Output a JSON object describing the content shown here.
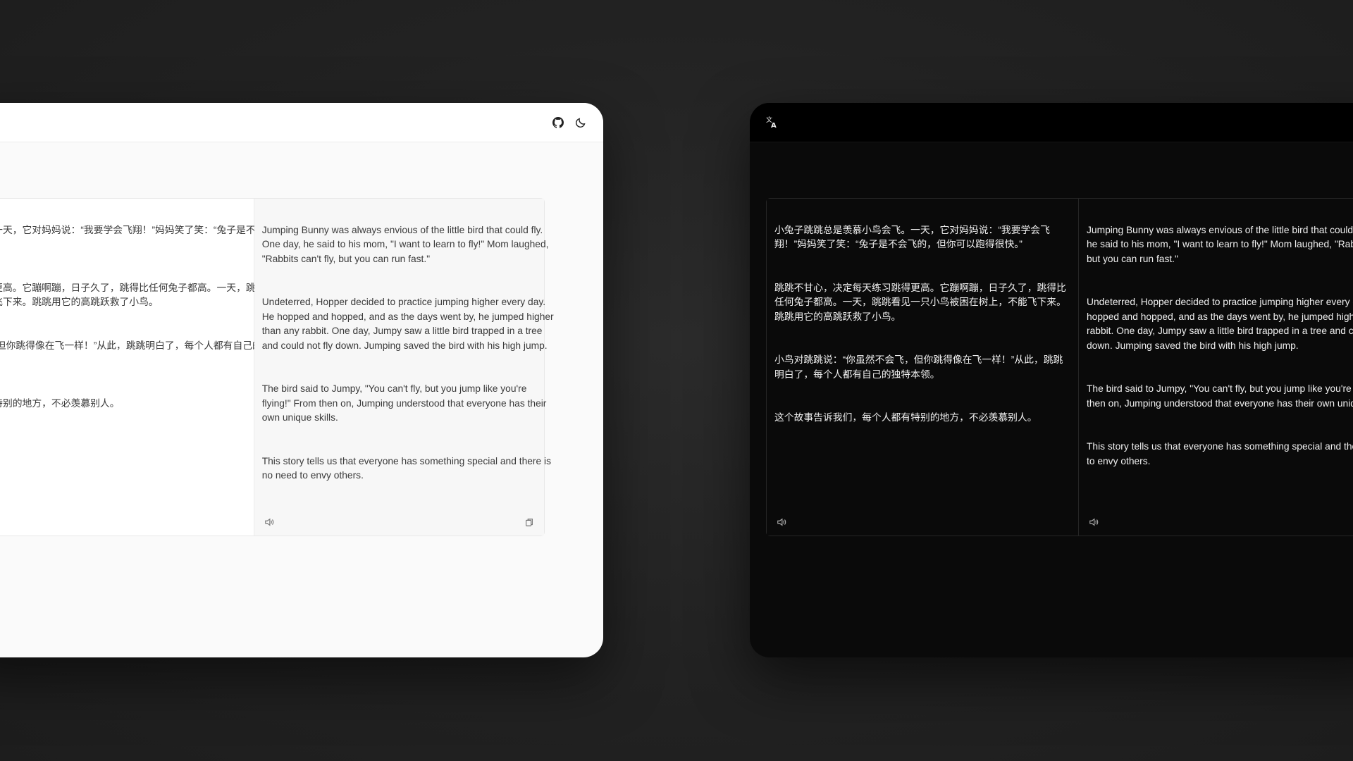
{
  "colors": {
    "background": "#232323",
    "light_window": "#fafafa",
    "dark_window": "#0a0a0a"
  },
  "icons": {
    "github": "github-icon",
    "theme": "moon-icon",
    "logo": "translate-icon",
    "speaker": "speaker-icon",
    "copy": "copy-icon"
  },
  "light": {
    "source": {
      "paragraphs": [
        "小兔子跳跳总是羡慕小鸟会飞。一天，它对妈妈说：“我要学会飞翔！”妈妈笑了笑：“兔子是不会飞的，但你可以跑得很快。”",
        "跳跳不甘心，决定每天练习跳得更高。它蹦啊蹦，日子久了，跳得比任何兔子都高。一天，跳跳看见一只小鸟被困在树上，不能飞下来。跳跳用它的高跳跃救了小鸟。",
        "小鸟对跳跳说：“你虽然不会飞，但你跳得像在飞一样！”从此，跳跳明白了，每个人都有自己的独特本领。",
        "这个故事告诉我们，每个人都有特别的地方，不必羡慕别人。"
      ]
    },
    "target": {
      "paragraphs": [
        "Jumping Bunny was always envious of the little bird that could fly. One day, he said to his mom, \"I want to learn to fly!\" Mom laughed, \"Rabbits can't fly, but you can run fast.\"",
        "Undeterred, Hopper decided to practice jumping higher every day. He hopped and hopped, and as the days went by, he jumped higher than any rabbit. One day, Jumpy saw a little bird trapped in a tree and could not fly down. Jumping saved the bird with his high jump.",
        "The bird said to Jumpy, \"You can't fly, but you jump like you're flying!\" From then on, Jumping understood that everyone has their own unique skills.",
        "This story tells us that everyone has something special and there is no need to envy others."
      ]
    }
  },
  "dark": {
    "source": {
      "paragraphs": [
        "小兔子跳跳总是羡慕小鸟会飞。一天，它对妈妈说：“我要学会飞翔！”妈妈笑了笑：“兔子是不会飞的，但你可以跑得很快。”",
        "跳跳不甘心，决定每天练习跳得更高。它蹦啊蹦，日子久了，跳得比任何兔子都高。一天，跳跳看见一只小鸟被困在树上，不能飞下来。跳跳用它的高跳跃救了小鸟。",
        "小鸟对跳跳说：“你虽然不会飞，但你跳得像在飞一样！”从此，跳跳明白了，每个人都有自己的独特本领。",
        "这个故事告诉我们，每个人都有特别的地方，不必羡慕别人。"
      ]
    },
    "target": {
      "paragraphs": [
        "Jumping Bunny was always envious of the little bird that could fly. One day, he said to his mom, \"I want to learn to fly!\" Mom laughed, \"Rabbits can't fly, but you can run fast.\"",
        "Undeterred, Hopper decided to practice jumping higher every day. He hopped and hopped, and as the days went by, he jumped higher than any rabbit. One day, Jumpy saw a little bird trapped in a tree and could not fly down. Jumping saved the bird with his high jump.",
        "The bird said to Jumpy, \"You can't fly, but you jump like you're flying!\" From then on, Jumping understood that everyone has their own unique skills.",
        "This story tells us that everyone has something special and there is no need to envy others."
      ]
    }
  }
}
